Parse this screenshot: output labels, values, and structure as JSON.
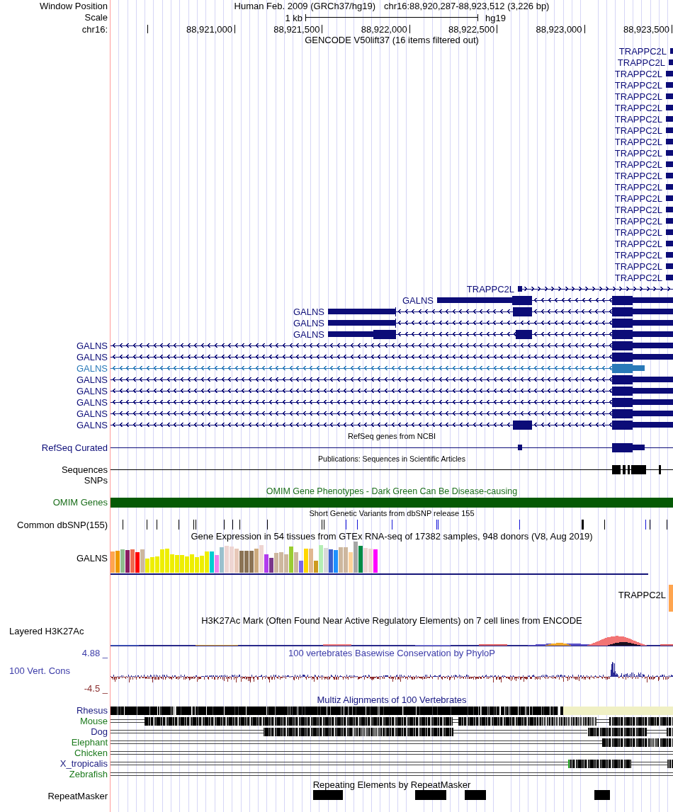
{
  "position": {
    "label": "Window Position",
    "assembly": "Human Feb. 2009 (GRCh37/hg19)",
    "range": "chr16:88,920,287-88,923,512 (3,226 bp)"
  },
  "scale": {
    "label": "Scale",
    "length": "1 kb",
    "assembly": "hg19"
  },
  "ruler": {
    "label": "chr16:",
    "ticks": [
      "88,921,000",
      "88,921,500",
      "88,922,000",
      "88,922,500",
      "88,923,000",
      "88,923,500"
    ]
  },
  "tracks": [
    {
      "kind": "genes",
      "title": "GENCODE V50lift37 (16 items filtered out)",
      "items": [
        {
          "label": "TRAPPC2L",
          "color": "#0c0c78"
        },
        {
          "label": "TRAPPC2L",
          "color": "#0c0c78"
        },
        {
          "label": "TRAPPC2L",
          "color": "#0c0c78"
        },
        {
          "label": "TRAPPC2L",
          "color": "#0c0c78"
        },
        {
          "label": "TRAPPC2L",
          "color": "#0c0c78"
        },
        {
          "label": "TRAPPC2L",
          "color": "#0c0c78"
        },
        {
          "label": "TRAPPC2L",
          "color": "#0c0c78"
        },
        {
          "label": "TRAPPC2L",
          "color": "#0c0c78"
        },
        {
          "label": "TRAPPC2L",
          "color": "#0c0c78"
        },
        {
          "label": "TRAPPC2L",
          "color": "#0c0c78"
        },
        {
          "label": "TRAPPC2L",
          "color": "#0c0c78"
        },
        {
          "label": "TRAPPC2L",
          "color": "#0c0c78"
        },
        {
          "label": "TRAPPC2L",
          "color": "#0c0c78"
        },
        {
          "label": "TRAPPC2L",
          "color": "#0c0c78"
        },
        {
          "label": "TRAPPC2L",
          "color": "#0c0c78"
        },
        {
          "label": "TRAPPC2L",
          "color": "#0c0c78"
        },
        {
          "label": "TRAPPC2L",
          "color": "#0c0c78"
        },
        {
          "label": "TRAPPC2L",
          "color": "#0c0c78"
        },
        {
          "label": "TRAPPC2L",
          "color": "#0c0c78"
        },
        {
          "label": "TRAPPC2L",
          "color": "#0c0c78"
        },
        {
          "label": "TRAPPC2L",
          "color": "#0c0c78"
        },
        {
          "label": "TRAPPC2L",
          "color": "#0c0c78"
        },
        {
          "label": "GALNS",
          "color": "#0c0c78"
        },
        {
          "label": "GALNS",
          "color": "#0c0c78"
        },
        {
          "label": "GALNS",
          "color": "#0c0c78"
        },
        {
          "label": "GALNS",
          "color": "#0c0c78"
        },
        {
          "label": "GALNS",
          "color": "#0c0c78"
        },
        {
          "label": "GALNS",
          "color": "#0c0c78"
        },
        {
          "label": "GALNS",
          "color": "#2a7ab8"
        },
        {
          "label": "GALNS",
          "color": "#0c0c78"
        },
        {
          "label": "GALNS",
          "color": "#0c0c78"
        },
        {
          "label": "GALNS",
          "color": "#0c0c78"
        },
        {
          "label": "GALNS",
          "color": "#0c0c78"
        },
        {
          "label": "GALNS",
          "color": "#0c0c78"
        }
      ]
    },
    {
      "kind": "refseq",
      "title": "RefSeq genes from NCBI",
      "label": "RefSeq Curated"
    },
    {
      "kind": "publications",
      "title": "Publications: Sequences in Scientific Articles",
      "rows": [
        {
          "label": "Sequences",
          "kind": "sequences"
        },
        {
          "label": "SNPs",
          "kind": "snps"
        }
      ]
    },
    {
      "kind": "omim",
      "title": "OMIM Gene Phenotypes - Dark Green Can Be Disease-causing",
      "label": "OMIM Genes"
    },
    {
      "kind": "dbsnp",
      "title": "Short Genetic Variants from dbSNP release 155",
      "label": "Common dbSNP(155)"
    },
    {
      "kind": "gtex",
      "title": "Gene Expression in 54 tissues from GTEx RNA-seq of 17382 samples, 948 donors (V8, Aug 2019)",
      "genes": [
        "GALNS",
        "TRAPPC2L"
      ]
    },
    {
      "kind": "h3k27ac",
      "title": "H3K27Ac Mark (Often Found Near Active Regulatory Elements) on 7 cell lines from ENCODE",
      "label": "Layered H3K27Ac"
    },
    {
      "kind": "phylop",
      "title": "100 vertebrates Basewise Conservation by PhyloP",
      "label": "100 Vert. Cons",
      "max_label": "4.88 _",
      "min_label": "-4.5 _"
    },
    {
      "kind": "multiz",
      "title": "Multiz Alignments of 100 Vertebrates",
      "species": [
        {
          "name": "Rhesus",
          "color": "#1a1a80"
        },
        {
          "name": "Mouse",
          "color": "#1c7a1c"
        },
        {
          "name": "Dog",
          "color": "#1a1a80"
        },
        {
          "name": "Elephant",
          "color": "#1c7a1c"
        },
        {
          "name": "Chicken",
          "color": "#1c7a1c"
        },
        {
          "name": "X_tropicalis",
          "color": "#1a1a80"
        },
        {
          "name": "Zebrafish",
          "color": "#1c7a1c"
        }
      ]
    },
    {
      "kind": "repeatmasker",
      "title": "Repeating Elements by RepeatMasker",
      "label": "RepeatMasker"
    }
  ]
}
